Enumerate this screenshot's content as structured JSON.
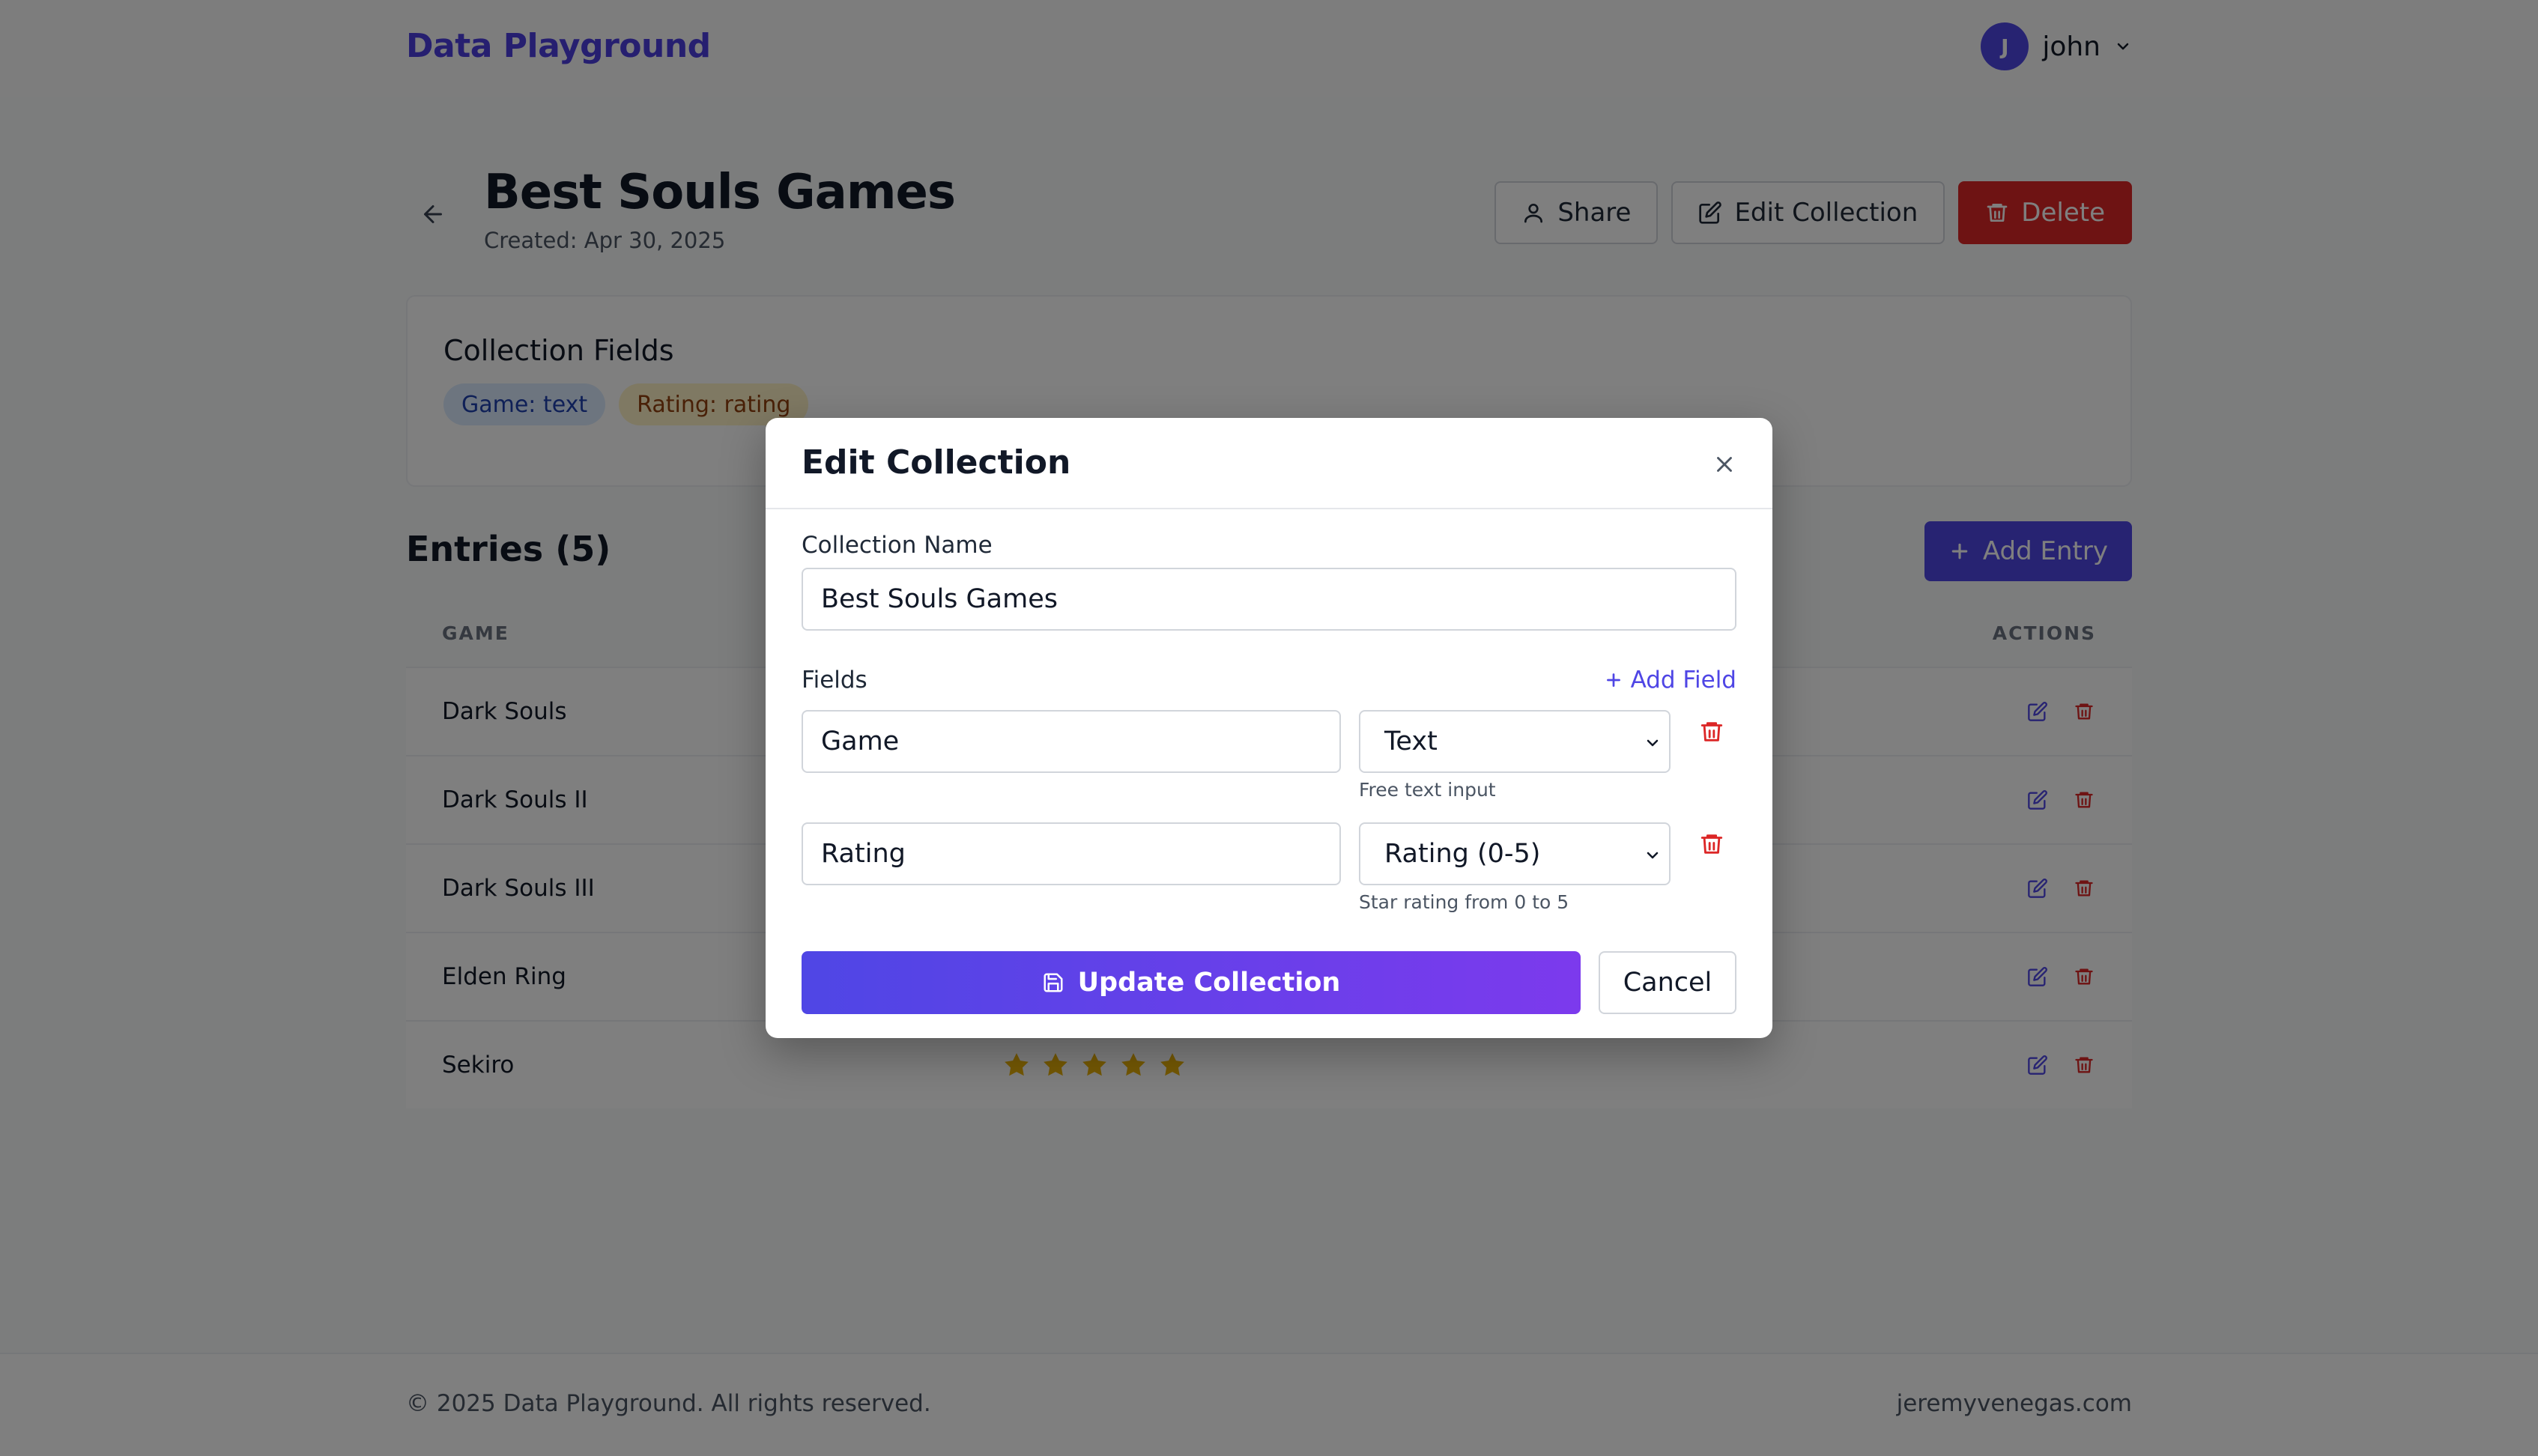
{
  "header": {
    "logo": "Data Playground",
    "user": {
      "initial": "J",
      "name": "john"
    }
  },
  "collection": {
    "title": "Best Souls Games",
    "created": "Created: Apr 30, 2025",
    "actions": {
      "share": "Share",
      "edit": "Edit Collection",
      "delete": "Delete"
    }
  },
  "fields_card": {
    "title": "Collection Fields",
    "chips": [
      "Game: text",
      "Rating: rating"
    ]
  },
  "entries": {
    "title": "Entries (5)",
    "add_label": "Add Entry",
    "columns": {
      "game": "GAME",
      "actions": "ACTIONS"
    },
    "rows": [
      {
        "game": "Dark Souls"
      },
      {
        "game": "Dark Souls II"
      },
      {
        "game": "Dark Souls III"
      },
      {
        "game": "Elden Ring"
      },
      {
        "game": "Sekiro",
        "rating": 5
      }
    ]
  },
  "footer": {
    "copyright": "© 2025 Data Playground. All rights reserved.",
    "link": "jeremyvenegas.com"
  },
  "modal": {
    "title": "Edit Collection",
    "name_label": "Collection Name",
    "name_value": "Best Souls Games",
    "fields_label": "Fields",
    "add_field_label": "Add Field",
    "fields": [
      {
        "name": "Game",
        "type": "Text",
        "hint": "Free text input"
      },
      {
        "name": "Rating",
        "type": "Rating (0-5)",
        "hint": "Star rating from 0 to 5"
      }
    ],
    "update_label": "Update Collection",
    "cancel_label": "Cancel"
  },
  "colors": {
    "brand": "#4f46e5",
    "danger": "#dc2626",
    "star": "#eab308",
    "overlay": "rgba(0,0,0,0.5)"
  },
  "icons": [
    "back-arrow-icon",
    "user-icon",
    "edit-icon",
    "trash-icon",
    "plus-icon",
    "star-icon",
    "close-icon",
    "save-icon",
    "chevron-down-icon"
  ]
}
